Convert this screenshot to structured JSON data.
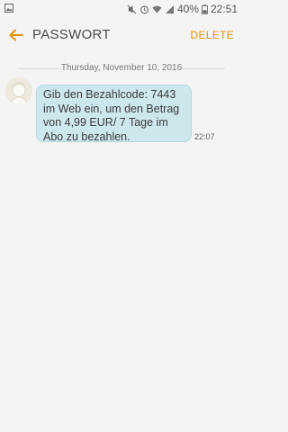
{
  "status_bar": {
    "battery_percent": "40%",
    "time": "22:51",
    "icons": [
      "image-icon",
      "mute-icon",
      "alarm-icon",
      "wifi-icon",
      "signal-icon",
      "battery-icon"
    ]
  },
  "header": {
    "title": "PASSWORT",
    "delete_label": "DELETE",
    "accent_color": "#e8930c"
  },
  "conversation": {
    "date": "Thursday, November 10, 2016",
    "messages": [
      {
        "text": "Gib den Bezahlcode: 7443 im Web ein, um den Betrag von 4,99 EUR/ 7 Tage im Abo zu bezahlen.",
        "time": "22:07",
        "bubble_color": "#cde8ed"
      }
    ]
  }
}
